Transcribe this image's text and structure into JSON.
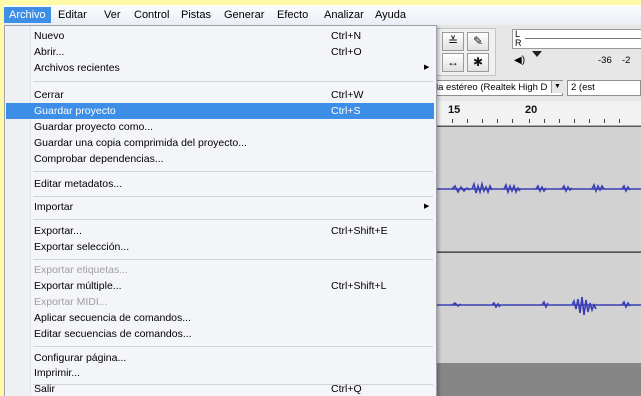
{
  "menubar": {
    "items": [
      "Archivo",
      "Editar",
      "Ver",
      "Control",
      "Pistas",
      "Generar",
      "Efecto",
      "Analizar",
      "Ayuda"
    ]
  },
  "file_menu": {
    "new": {
      "label": "Nuevo",
      "shortcut": "Ctrl+N"
    },
    "open": {
      "label": "Abrir...",
      "shortcut": "Ctrl+O"
    },
    "recent": {
      "label": "Archivos recientes"
    },
    "close": {
      "label": "Cerrar",
      "shortcut": "Ctrl+W"
    },
    "save_project": {
      "label": "Guardar proyecto",
      "shortcut": "Ctrl+S"
    },
    "save_project_as": {
      "label": "Guardar proyecto como..."
    },
    "save_compressed": {
      "label": "Guardar una copia comprimida del proyecto..."
    },
    "check_deps": {
      "label": "Comprobar dependencias..."
    },
    "edit_metadata": {
      "label": "Editar metadatos..."
    },
    "import": {
      "label": "Importar"
    },
    "export": {
      "label": "Exportar...",
      "shortcut": "Ctrl+Shift+E"
    },
    "export_selection": {
      "label": "Exportar selección..."
    },
    "export_labels": {
      "label": "Exportar etiquetas..."
    },
    "export_multiple": {
      "label": "Exportar múltiple...",
      "shortcut": "Ctrl+Shift+L"
    },
    "export_midi": {
      "label": "Exportar MIDI..."
    },
    "apply_chain": {
      "label": "Aplicar secuencia de comandos..."
    },
    "edit_chains": {
      "label": "Editar secuencias de comandos..."
    },
    "page_setup": {
      "label": "Configurar página..."
    },
    "print": {
      "label": "Imprimir..."
    },
    "exit": {
      "label": "Salir",
      "shortcut": "Ctrl+Q"
    }
  },
  "toolbar": {
    "meter_l": "L",
    "meter_r": "R",
    "db_1": "-36",
    "db_2": "-2",
    "device": "la estéreo (Realtek High D",
    "channels": "2 (est"
  },
  "ruler": {
    "mark_1": "15",
    "mark_2": "20"
  },
  "colors": {
    "accent": "#3d8ee6",
    "waveform": "#3a3fb5",
    "background_highlight": "#fff9a8"
  }
}
